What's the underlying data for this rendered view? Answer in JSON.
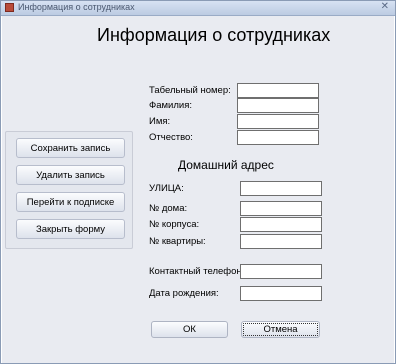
{
  "window": {
    "title": "Информация о сотрудниках",
    "close_glyph": "✕"
  },
  "form": {
    "heading": "Информация о сотрудниках",
    "fields": {
      "tab_number": {
        "label": "Табельный номер:",
        "value": ""
      },
      "last_name": {
        "label": "Фамилия:",
        "value": ""
      },
      "first_name": {
        "label": "Имя:",
        "value": ""
      },
      "patronymic": {
        "label": "Отчество:",
        "value": ""
      }
    },
    "address_section": "Домашний адрес",
    "address": {
      "street": {
        "label": "УЛИЦА:",
        "value": ""
      },
      "house": {
        "label": "№ дома:",
        "value": ""
      },
      "building": {
        "label": "№ корпуса:",
        "value": ""
      },
      "apartment": {
        "label": "№ квартиры:",
        "value": ""
      }
    },
    "contact_phone": {
      "label": "Контактный телефон:",
      "value": ""
    },
    "birth_date": {
      "label": "Дата рождения:",
      "value": ""
    }
  },
  "actions": {
    "save": "Сохранить запись",
    "delete": "Удалить запись",
    "goto_subscription": "Перейти к подписке",
    "close_form": "Закрыть форму",
    "ok": "ОК",
    "cancel": "Отмена"
  }
}
